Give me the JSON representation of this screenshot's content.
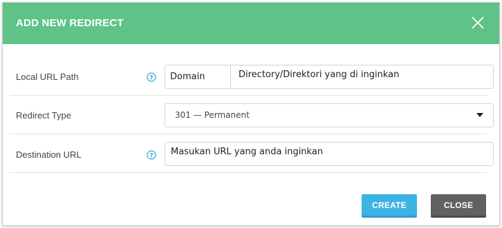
{
  "dialog": {
    "title": "ADD NEW REDIRECT",
    "close_icon": "close-x-icon"
  },
  "form": {
    "local_url": {
      "label": "Local URL Path",
      "help_icon": "question-circle-icon",
      "domain_addon": "Domain",
      "value": "Directory/Direktori yang di inginkan"
    },
    "redirect_type": {
      "label": "Redirect Type",
      "selected": "301 — Permanent",
      "caret_icon": "caret-down-icon"
    },
    "destination_url": {
      "label": "Destination URL",
      "help_icon": "question-circle-icon",
      "value": "Masukan URL yang anda inginkan"
    }
  },
  "buttons": {
    "create": "CREATE",
    "close": "CLOSE"
  },
  "colors": {
    "header": "#5fc387",
    "create_button": "#3bb4e5",
    "close_button": "#616161",
    "help_icon": "#2aa3d6"
  }
}
